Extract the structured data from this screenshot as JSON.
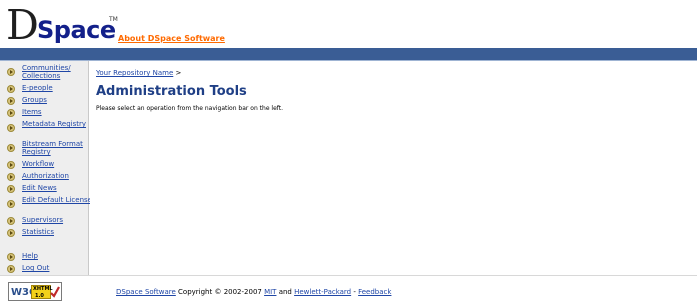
{
  "header": {
    "logo_d": "D",
    "logo_space": "Space",
    "logo_tm": "TM",
    "about_link": "About DSpace Software"
  },
  "sidebar": {
    "items": [
      {
        "label": "Communities/ Collections"
      },
      {
        "label": "E-people"
      },
      {
        "label": "Groups"
      },
      {
        "label": "Items"
      },
      {
        "label": "Metadata Registry"
      },
      {
        "label": "Bitstream Format Registry"
      },
      {
        "label": "Workflow"
      },
      {
        "label": "Authorization"
      },
      {
        "label": "Edit News"
      },
      {
        "label": "Edit Default License"
      },
      {
        "label": "Supervisors"
      },
      {
        "label": "Statistics"
      },
      {
        "label": "Help"
      },
      {
        "label": "Log Out"
      }
    ]
  },
  "main": {
    "breadcrumb_link": "Your Repository Name",
    "breadcrumb_sep": " >",
    "title": "Administration Tools",
    "intro": "Please select an operation from the navigation bar on the left."
  },
  "footer": {
    "w3c": "W3C",
    "xhtml": "XHTML",
    "xhtml_version": "1.0",
    "dspace_software": "DSpace Software",
    "copyright": " Copyright © 2002-2007 ",
    "mit": "MIT",
    "and": " and ",
    "hp": "Hewlett-Packard",
    "dash": " - ",
    "feedback": "Feedback"
  },
  "colors": {
    "header_bar": "#3a5d95",
    "link": "#1f46a6",
    "title": "#1f3f86",
    "about_link": "#ff6a00",
    "sidebar_bg": "#eeeeee"
  }
}
